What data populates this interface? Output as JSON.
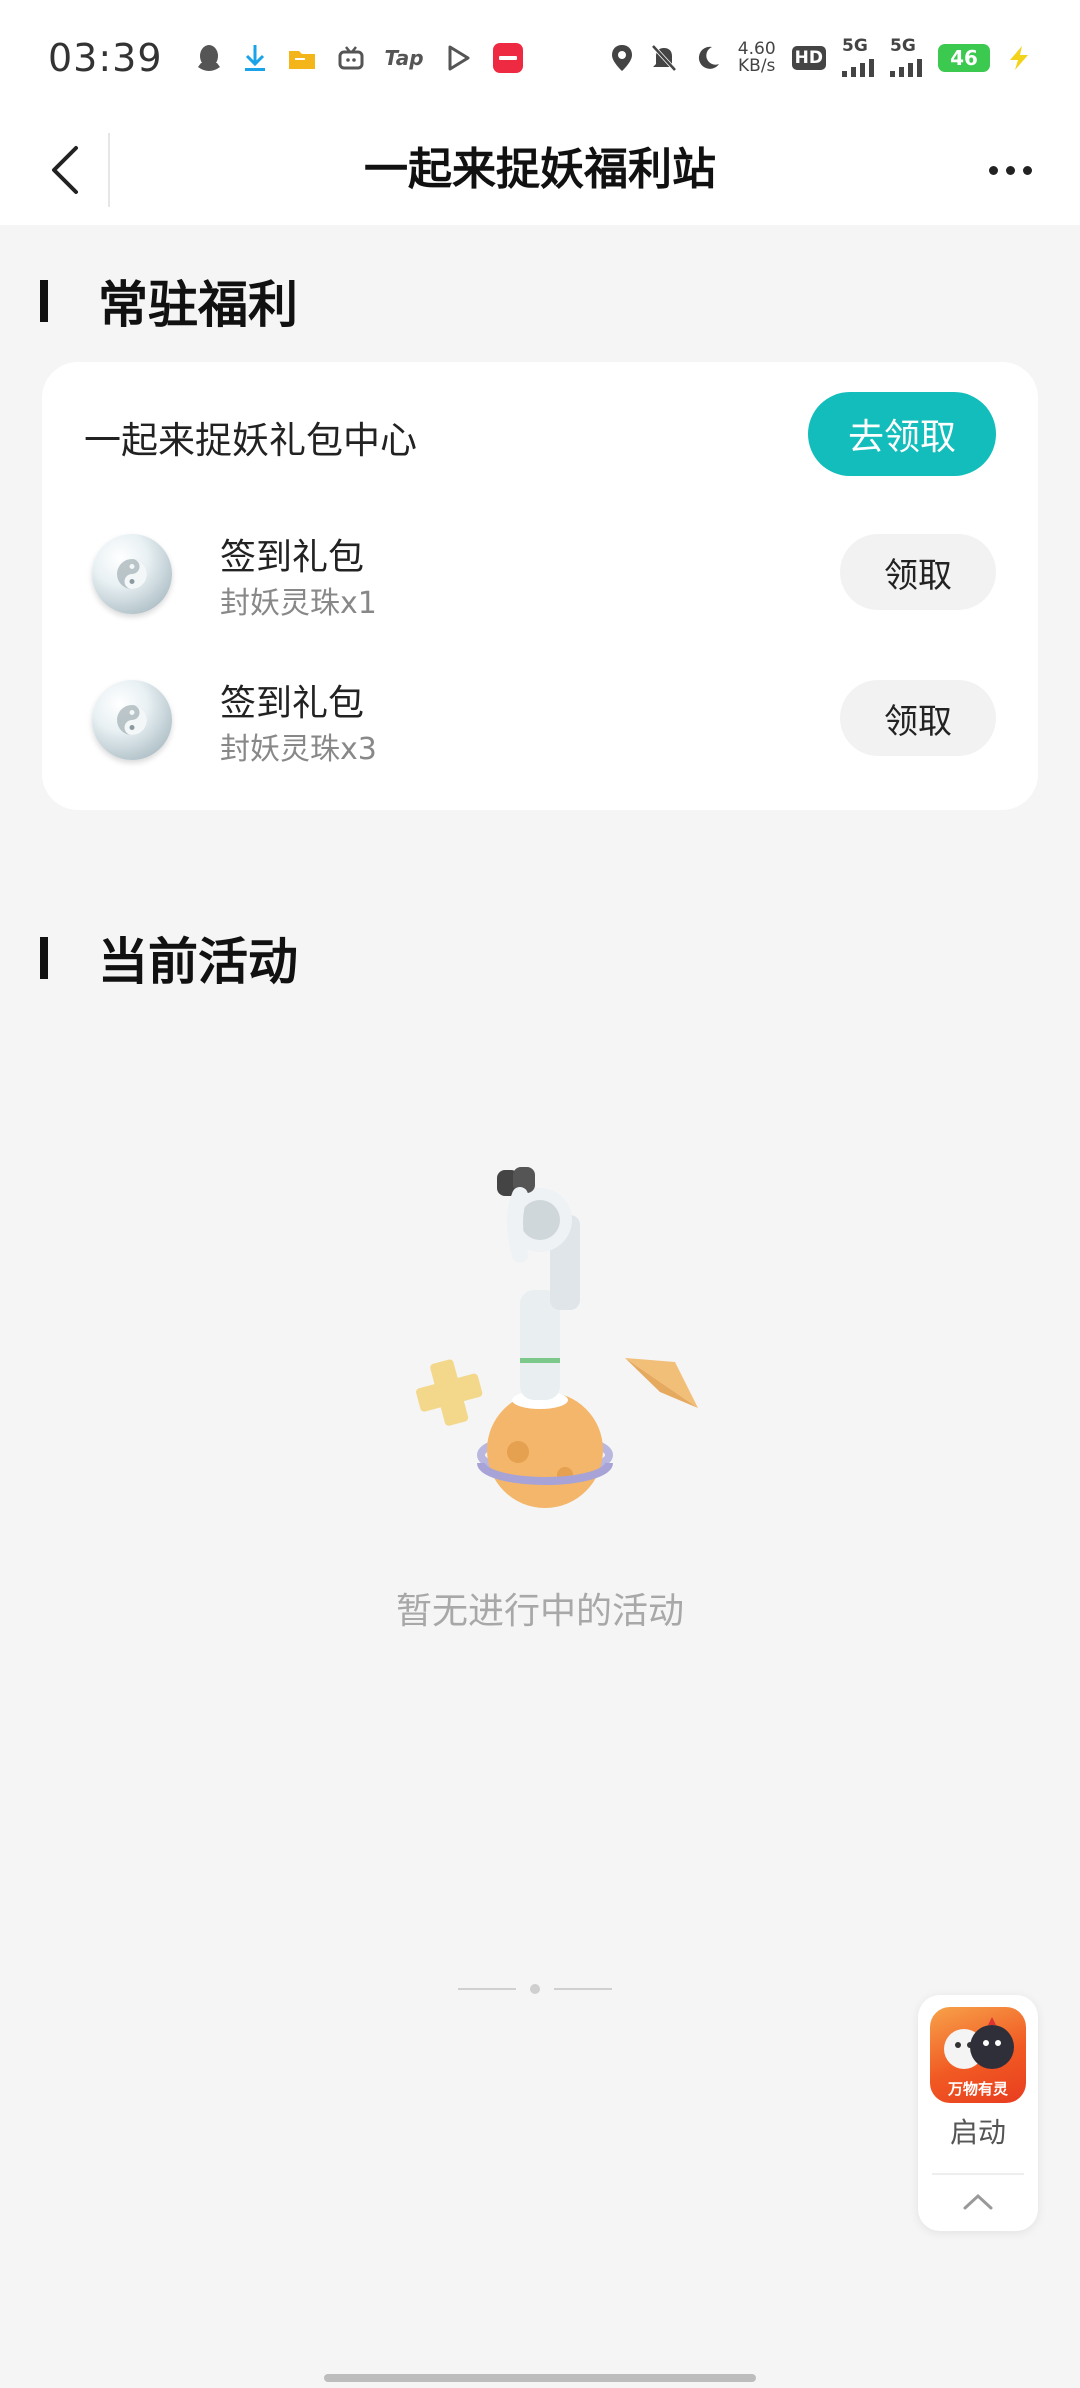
{
  "status_bar": {
    "time": "03:39",
    "net_speed_value": "4.60",
    "net_speed_unit": "KB/s",
    "hd_label": "HD",
    "sim1_label": "5G",
    "sim2_label": "5G",
    "battery": "46",
    "app_icon_tap": "Tap"
  },
  "nav": {
    "title": "一起来捉妖福利站"
  },
  "sections": {
    "resident": "常驻福利",
    "current": "当前活动"
  },
  "card": {
    "title": "一起来捉妖礼包中心",
    "go_claim_label": "去领取",
    "gifts": [
      {
        "name": "签到礼包",
        "desc": "封妖灵珠x1",
        "button": "领取"
      },
      {
        "name": "签到礼包",
        "desc": "封妖灵珠x3",
        "button": "领取"
      }
    ]
  },
  "empty_state": {
    "text": "暂无进行中的活动"
  },
  "float_panel": {
    "game_label": "万物有灵",
    "launch_label": "启动"
  },
  "colors": {
    "accent": "#12bdbb",
    "background": "#f5f5f5"
  }
}
